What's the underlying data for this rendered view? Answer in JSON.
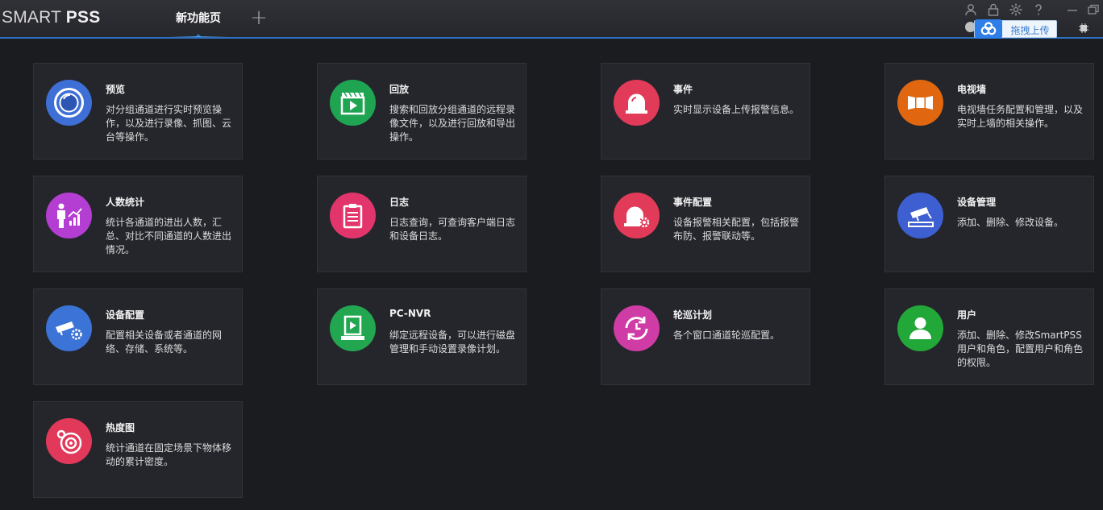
{
  "app": {
    "logo_light": "SMART ",
    "logo_bold": "PSS"
  },
  "tabs": [
    {
      "label": "新功能页",
      "active": true
    }
  ],
  "toolbar": {
    "add_tab": "+",
    "upload_label": "拖拽上传",
    "icons": [
      "user-icon",
      "lock-icon",
      "settings-icon",
      "help-icon",
      "minimize-icon",
      "restore-icon"
    ]
  },
  "colors": {
    "preview": "#3d6fd6",
    "playback": "#1fa552",
    "event": "#e23a59",
    "tvwall": "#e0670f",
    "people_count": "#b43ed1",
    "log": "#e2356c",
    "event_config": "#e23a59",
    "device_manage": "#3e5fd1",
    "device_config": "#3b74d6",
    "pcnvr": "#22a650",
    "tour": "#d03ca6",
    "user": "#22a838",
    "heatmap": "#e2385a",
    "accent": "#2f6fbf"
  },
  "cards": [
    {
      "title": "预览",
      "desc": "对分组通道进行实时预览操作，以及进行录像、抓图、云台等操作。"
    },
    {
      "title": "回放",
      "desc": "搜索和回放分组通道的远程录像文件，以及进行回放和导出操作。"
    },
    {
      "title": "事件",
      "desc": "实时显示设备上传报警信息。"
    },
    {
      "title": "电视墙",
      "desc": "电视墙任务配置和管理，以及实时上墙的相关操作。"
    },
    {
      "title": "人数统计",
      "desc": "统计各通道的进出人数，汇总、对比不同通道的人数进出情况。"
    },
    {
      "title": "日志",
      "desc": "日志查询，可查询客户端日志和设备日志。"
    },
    {
      "title": "事件配置",
      "desc": "设备报警相关配置，包括报警布防、报警联动等。"
    },
    {
      "title": "设备管理",
      "desc": "添加、删除、修改设备。"
    },
    {
      "title": "设备配置",
      "desc": "配置相关设备或者通道的网络、存储、系统等。"
    },
    {
      "title": "PC-NVR",
      "desc": "绑定远程设备，可以进行磁盘管理和手动设置录像计划。"
    },
    {
      "title": "轮巡计划",
      "desc": "各个窗口通道轮巡配置。"
    },
    {
      "title": "用户",
      "desc": "添加、删除、修改SmartPSS用户和角色，配置用户和角色的权限。"
    },
    {
      "title": "热度图",
      "desc": "统计通道在固定场景下物体移动的累计密度。"
    }
  ]
}
